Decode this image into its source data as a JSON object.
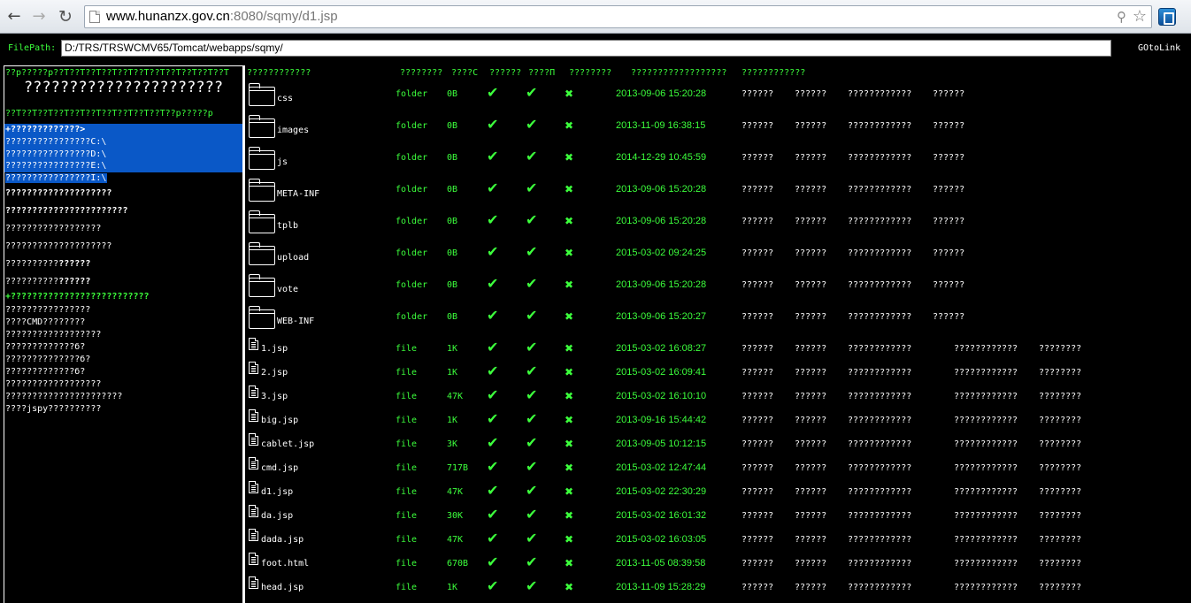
{
  "browser": {
    "url_host": "www.hunanzx.gov.cn",
    "url_rest": ":8080/sqmy/d1.jsp",
    "icons": [
      "back-arrow-icon",
      "forward-arrow-icon",
      "reload-icon",
      "page-icon",
      "key-icon",
      "star-icon",
      "extension-icon"
    ]
  },
  "pathbar": {
    "label": "FilePath:",
    "value": "D:/TRS/TRSWCMV65/Tomcat/webapps/sqmy/",
    "goto_label": "GOtoLink"
  },
  "left_panel": {
    "top_line": "??p?????p??T??T??T??T??T??T??T??T??T??T??T",
    "title": "??????????????????????",
    "second_line": "??T??T??T??T??T??T??T??T??T??T??p?????p",
    "drives": [
      "+?????????????>",
      "????????????????C:\\",
      "????????????????D:\\",
      "????????????????E:\\",
      "????????????????I:\\"
    ],
    "menu_bold_1": "????????????????????",
    "menu_bold_2": "???????????????????????",
    "menu_3": "??????????????????",
    "menu_4": "????????????????????",
    "menu_5a": "??????????",
    "menu_5b": "??????",
    "menu_6a": "??????????",
    "menu_6b": "??????",
    "section_header": "+??????????????????????????",
    "items": [
      "????????????????",
      "????CMD????????",
      "??????????????????",
      "?????????????б?",
      "??????????????б?",
      "?????????????б?",
      "??????????????????",
      "??????????????????????",
      "????jspy??????????"
    ]
  },
  "table": {
    "headers": [
      "????????????",
      "????????",
      "????C",
      "??????",
      "????П",
      "????????",
      "??????????????????",
      "????????????"
    ],
    "folder_cols": [
      "??????",
      "??????",
      "????????????",
      "??????"
    ],
    "file_cols": [
      "??????",
      "??????",
      "????????????",
      "????????",
      "????",
      "????????"
    ],
    "folders": [
      {
        "name": "css",
        "type": "folder",
        "size": "0B",
        "date": "2013-09-06 15:20:28"
      },
      {
        "name": "images",
        "type": "folder",
        "size": "0B",
        "date": "2013-11-09 16:38:15"
      },
      {
        "name": "js",
        "type": "folder",
        "size": "0B",
        "date": "2014-12-29 10:45:59"
      },
      {
        "name": "META-INF",
        "type": "folder",
        "size": "0B",
        "date": "2013-09-06 15:20:28"
      },
      {
        "name": "tplb",
        "type": "folder",
        "size": "0B",
        "date": "2013-09-06 15:20:28"
      },
      {
        "name": "upload",
        "type": "folder",
        "size": "0B",
        "date": "2015-03-02 09:24:25"
      },
      {
        "name": "vote",
        "type": "folder",
        "size": "0B",
        "date": "2013-09-06 15:20:28"
      },
      {
        "name": "WEB-INF",
        "type": "folder",
        "size": "0B",
        "date": "2013-09-06 15:20:27"
      }
    ],
    "files": [
      {
        "name": "1.jsp",
        "type": "file",
        "size": "1K",
        "date": "2015-03-02 16:08:27"
      },
      {
        "name": "2.jsp",
        "type": "file",
        "size": "1K",
        "date": "2015-03-02 16:09:41"
      },
      {
        "name": "3.jsp",
        "type": "file",
        "size": "47K",
        "date": "2015-03-02 16:10:10"
      },
      {
        "name": "big.jsp",
        "type": "file",
        "size": "1K",
        "date": "2013-09-16 15:44:42"
      },
      {
        "name": "cablet.jsp",
        "type": "file",
        "size": "3K",
        "date": "2013-09-05 10:12:15"
      },
      {
        "name": "cmd.jsp",
        "type": "file",
        "size": "717B",
        "date": "2015-03-02 12:47:44"
      },
      {
        "name": "d1.jsp",
        "type": "file",
        "size": "47K",
        "date": "2015-03-02 22:30:29"
      },
      {
        "name": "da.jsp",
        "type": "file",
        "size": "30K",
        "date": "2015-03-02 16:01:32"
      },
      {
        "name": "dada.jsp",
        "type": "file",
        "size": "47K",
        "date": "2015-03-02 16:03:05"
      },
      {
        "name": "foot.html",
        "type": "file",
        "size": "670B",
        "date": "2013-11-05 08:39:58"
      },
      {
        "name": "head.jsp",
        "type": "file",
        "size": "1K",
        "date": "2013-11-09 15:28:29"
      }
    ],
    "tick_glyph": "✔",
    "cross_glyph": "✖",
    "colors": {
      "accent_green": "#3cff3c",
      "selection_blue": "#0a58c7",
      "background": "#000000"
    }
  }
}
